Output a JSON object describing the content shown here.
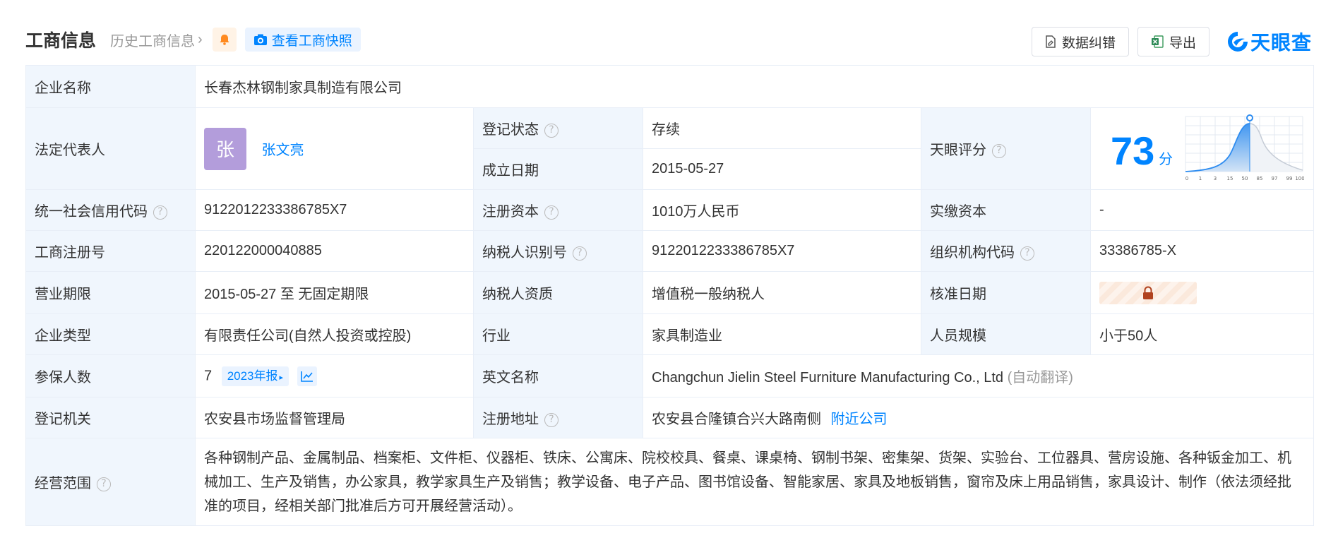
{
  "header": {
    "title": "工商信息",
    "history_link": "历史工商信息",
    "snapshot_button": "查看工商快照",
    "correction_button": "数据纠错",
    "export_button": "导出",
    "brand_name": "天眼查"
  },
  "colors": {
    "accent": "#0084ff",
    "label_bg": "#f0f6fd",
    "status_green": "#24a148",
    "avatar_purple": "#b39ddb"
  },
  "company": {
    "name_label": "企业名称",
    "name": "长春杰林钢制家具制造有限公司",
    "rep_label": "法定代表人",
    "rep_avatar_char": "张",
    "rep_name": "张文亮",
    "status_label": "登记状态",
    "status": "存续",
    "founded_label": "成立日期",
    "founded": "2015-05-27",
    "score_label": "天眼评分",
    "score": "73",
    "score_unit": "分",
    "score_axis": [
      "0",
      "1",
      "3",
      "15",
      "50",
      "85",
      "97",
      "99",
      "100"
    ],
    "credit_label": "统一社会信用代码",
    "credit_code": "9122012233386785X7",
    "capital_label": "注册资本",
    "capital": "1010万人民币",
    "paid_label": "实缴资本",
    "paid": "-",
    "reg_no_label": "工商注册号",
    "reg_no": "220122000040885",
    "taxpayer_id_label": "纳税人识别号",
    "taxpayer_id": "9122012233386785X7",
    "org_code_label": "组织机构代码",
    "org_code": "33386785-X",
    "term_label": "营业期限",
    "term": "2015-05-27 至 无固定期限",
    "taxpayer_qual_label": "纳税人资质",
    "taxpayer_qual": "增值税一般纳税人",
    "approved_label": "核准日期",
    "type_label": "企业类型",
    "type": "有限责任公司(自然人投资或控股)",
    "industry_label": "行业",
    "industry": "家具制造业",
    "staff_label": "人员规模",
    "staff": "小于50人",
    "insured_label": "参保人数",
    "insured": "7",
    "insured_year": "2023年报",
    "english_label": "英文名称",
    "english_name": "Changchun Jielin Steel Furniture Manufacturing Co., Ltd",
    "auto_translate": "(自动翻译)",
    "authority_label": "登记机关",
    "authority": "农安县市场监督管理局",
    "address_label": "注册地址",
    "address": "农安县合隆镇合兴大路南侧",
    "nearby_link": "附近公司",
    "scope_label": "经营范围",
    "scope": "各种钢制产品、金属制品、档案柜、文件柜、仪器柜、铁床、公寓床、院校校具、餐桌、课桌椅、钢制书架、密集架、货架、实验台、工位器具、营房设施、各种钣金加工、机械加工、生产及销售，办公家具，教学家具生产及销售；教学设备、电子产品、图书馆设备、智能家居、家具及地板销售，窗帘及床上用品销售，家具设计、制作（依法须经批准的项目，经相关部门批准后方可开展经营活动）。"
  }
}
